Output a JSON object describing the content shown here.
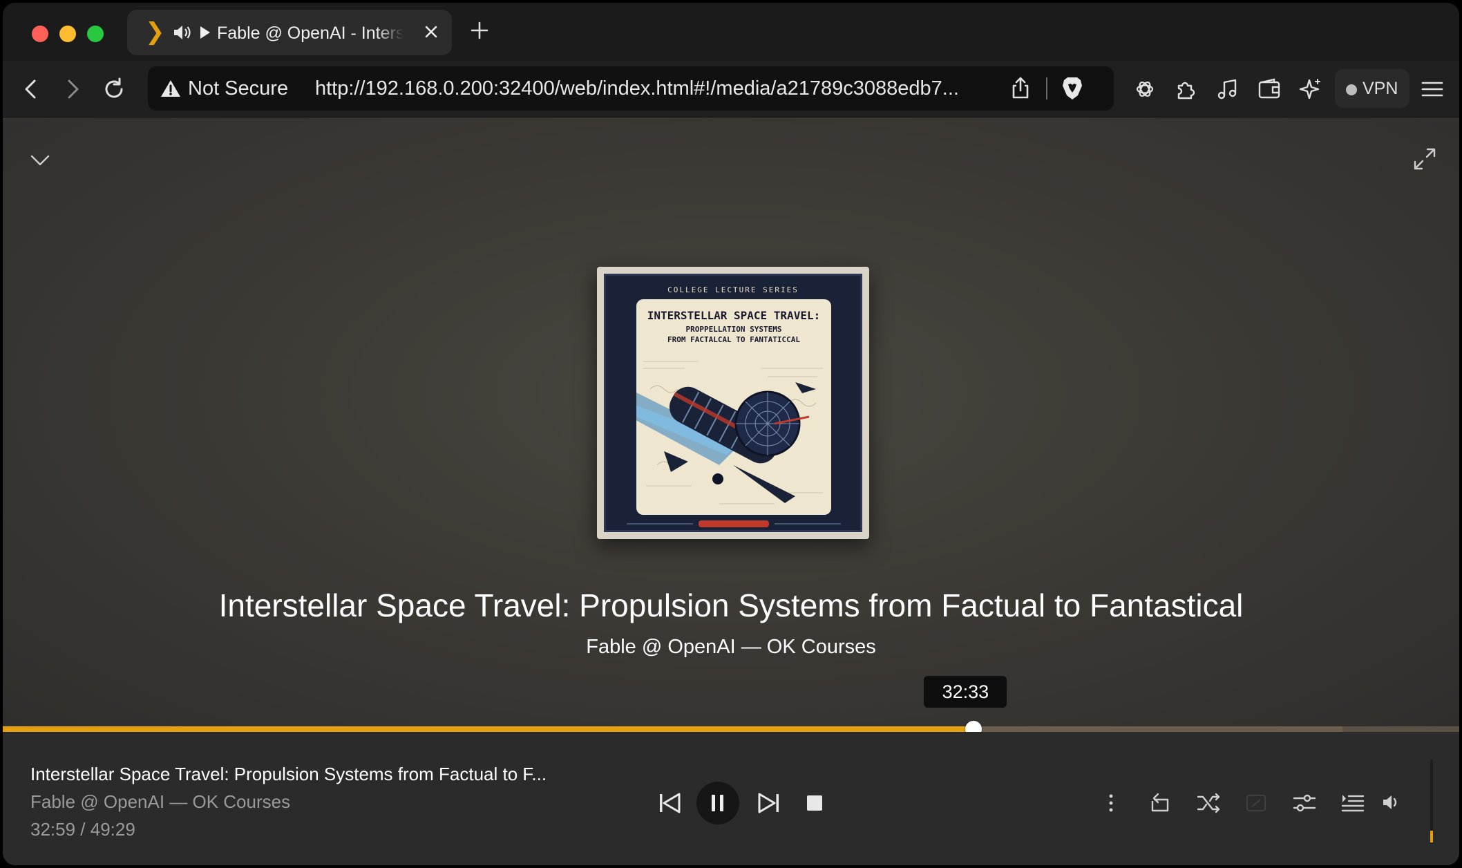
{
  "browser": {
    "tab": {
      "title": "Fable @ OpenAI - Interstellar Space Travel: Propulsion Systems from Factual to Fantastical"
    },
    "address_bar": {
      "security_label": "Not Secure",
      "url": "http://192.168.0.200:32400/web/index.html#!/media/a21789c3088edb7..."
    },
    "vpn_label": "VPN"
  },
  "now_playing": {
    "cover": {
      "series": "COLLEGE LECTURE SERIES",
      "title": "INTERSTELLAR SPACE TRAVEL:",
      "subtitle_line1": "PROPPELLATION SYSTEMS",
      "subtitle_line2": "FROM FACTALCAL TO FANTATICCAL"
    },
    "title": "Interstellar Space Travel: Propulsion Systems from Factual to Fantastical",
    "artist_line": "Fable @ OpenAI — OK Courses",
    "hover_time": "32:33"
  },
  "player_bar": {
    "title": "Interstellar Space Travel: Propulsion Systems from Factual to F...",
    "artist_line": "Fable @ OpenAI — OK Courses",
    "time": "32:59 / 49:29",
    "progress_fraction": 0.6667,
    "buffered_fraction": 0.92,
    "volume_fraction": 0.14
  },
  "colors": {
    "accent": "#e5a00d",
    "player_bg": "#2b2b2b",
    "window_bg": "#1e1e1e"
  }
}
